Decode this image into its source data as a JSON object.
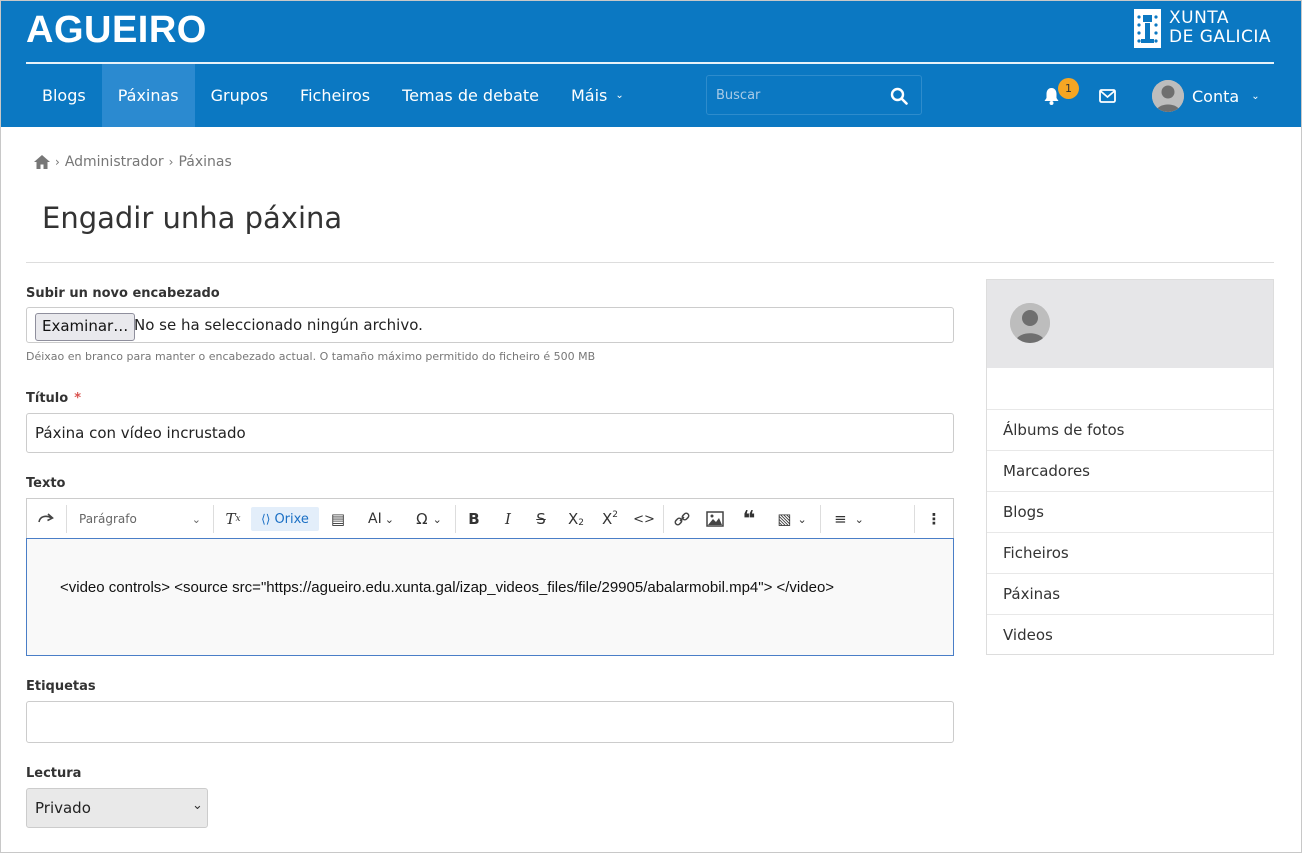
{
  "header": {
    "site_title": "AGUEIRO",
    "gov_line1": "XUNTA",
    "gov_line2": "DE GALICIA",
    "nav": [
      "Blogs",
      "Páxinas",
      "Grupos",
      "Ficheiros",
      "Temas de debate",
      "Máis"
    ],
    "active_nav": "Páxinas",
    "search_placeholder": "Buscar",
    "notification_count": "1",
    "account_label": "Conta",
    "bar_color": "#0b78c2"
  },
  "breadcrumb": [
    "Administrador",
    "Páxinas"
  ],
  "page_title": "Engadir unha páxina",
  "form": {
    "header_upload": {
      "label": "Subir un novo encabezado",
      "button": "Examinar…",
      "status": "No se ha seleccionado ningún archivo.",
      "help": "Déixao en branco para manter o encabezado actual. O tamaño máximo permitido do ficheiro é 500 MB"
    },
    "title": {
      "label": "Título",
      "required_mark": "*",
      "value": "Páxina con vídeo incrustado"
    },
    "text": {
      "label": "Texto",
      "paragraph_style": "Parágrafo",
      "source_button": "Orixe",
      "content": "<video controls> <source src=\"https://agueiro.edu.xunta.gal/izap_videos_files/file/29905/abalarmobil.mp4\"> </video>"
    },
    "tags": {
      "label": "Etiquetas",
      "value": ""
    },
    "access": {
      "label": "Lectura",
      "selected": "Privado"
    }
  },
  "sidebar": {
    "items": [
      "Álbums de fotos",
      "Marcadores",
      "Blogs",
      "Ficheiros",
      "Páxinas",
      "Videos"
    ]
  }
}
